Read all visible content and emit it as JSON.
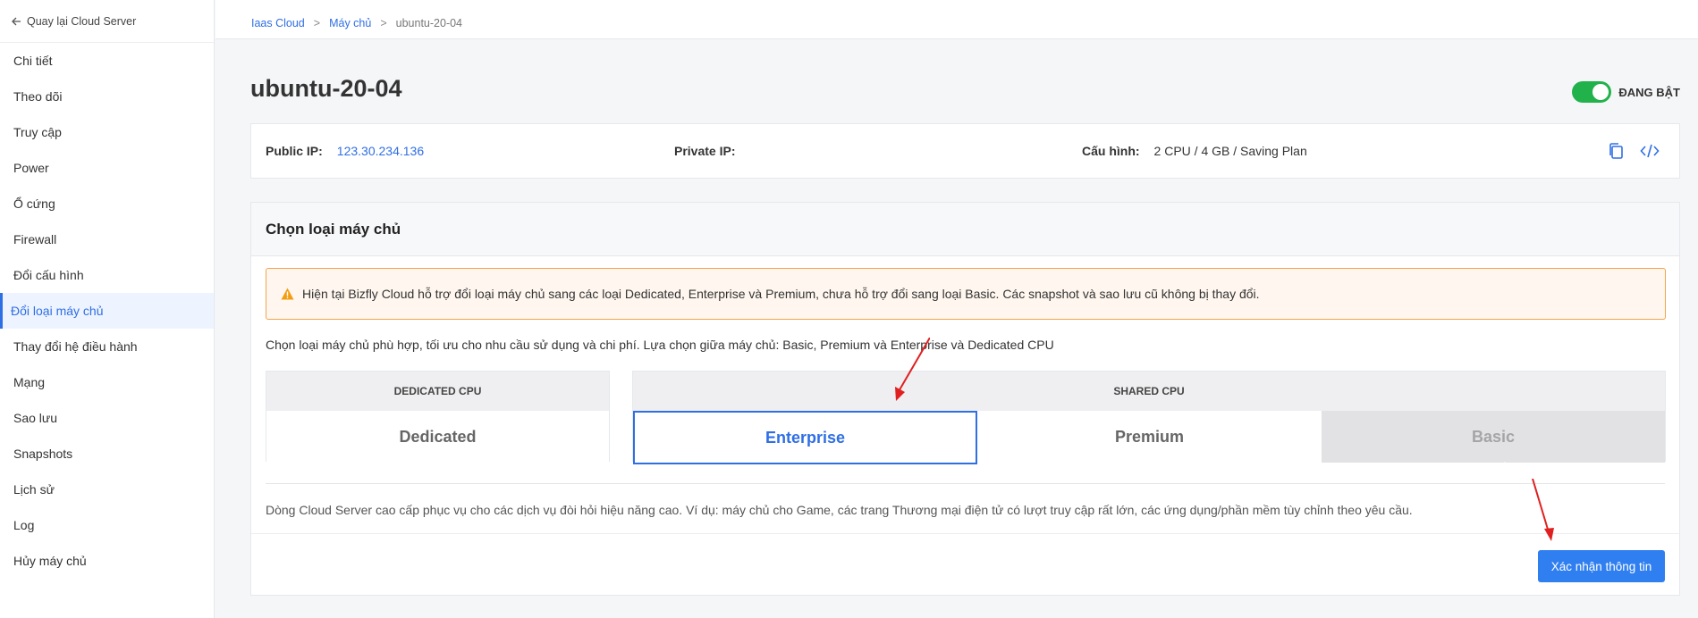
{
  "sidebar": {
    "back_label": "Quay lại Cloud Server",
    "items": [
      {
        "label": "Chi tiết"
      },
      {
        "label": "Theo dõi"
      },
      {
        "label": "Truy cập"
      },
      {
        "label": "Power"
      },
      {
        "label": "Ổ cứng"
      },
      {
        "label": "Firewall"
      },
      {
        "label": "Đổi cấu hình"
      },
      {
        "label": "Đổi loại máy chủ",
        "active": true
      },
      {
        "label": "Thay đổi hệ điều hành"
      },
      {
        "label": "Mạng"
      },
      {
        "label": "Sao lưu"
      },
      {
        "label": "Snapshots"
      },
      {
        "label": "Lịch sử"
      },
      {
        "label": "Log"
      },
      {
        "label": "Hủy máy chủ"
      }
    ]
  },
  "breadcrumb": {
    "items": [
      "Iaas Cloud",
      "Máy chủ",
      "ubuntu-20-04"
    ],
    "separator": ">"
  },
  "server": {
    "name": "ubuntu-20-04",
    "status_label": "ĐANG BẬT",
    "status_on": true
  },
  "info": {
    "public_ip_label": "Public IP:",
    "public_ip": "123.30.234.136",
    "private_ip_label": "Private IP:",
    "private_ip": "",
    "config_label": "Cấu hình:",
    "config": "2 CPU / 4 GB / Saving Plan",
    "icons": [
      "copy-icon",
      "code-icon"
    ]
  },
  "card": {
    "title": "Chọn loại máy chủ",
    "alert": "Hiện tại Bizfly Cloud hỗ trợ đổi loại máy chủ sang các loại Dedicated, Enterprise và Premium, chưa hỗ trợ đổi sang loại Basic. Các snapshot và sao lưu cũ không bị thay đổi.",
    "description": "Chọn loại máy chủ phù hợp, tối ưu cho nhu cầu sử dụng và chi phí. Lựa chọn giữa máy chủ: Basic, Premium và Enterprise và Dedicated CPU",
    "groups": {
      "dedicated": {
        "header": "DEDICATED CPU",
        "options": [
          "Dedicated"
        ]
      },
      "shared": {
        "header": "SHARED CPU",
        "options": [
          "Enterprise",
          "Premium",
          "Basic"
        ]
      }
    },
    "selected": "Enterprise",
    "disabled": "Basic",
    "note": "Dòng Cloud Server cao cấp phục vụ cho các dịch vụ đòi hỏi hiệu năng cao. Ví dụ: máy chủ cho Game, các trang Thương mại điện tử có lượt truy cập rất lớn, các ứng dụng/phần mềm tùy chỉnh theo yêu cầu.",
    "confirm_label": "Xác nhận thông tin"
  },
  "colors": {
    "accent": "#2f6fe4",
    "toggle_on": "#21b24b",
    "alert_border": "#f5a44a",
    "annotation_arrow": "#e02020"
  }
}
